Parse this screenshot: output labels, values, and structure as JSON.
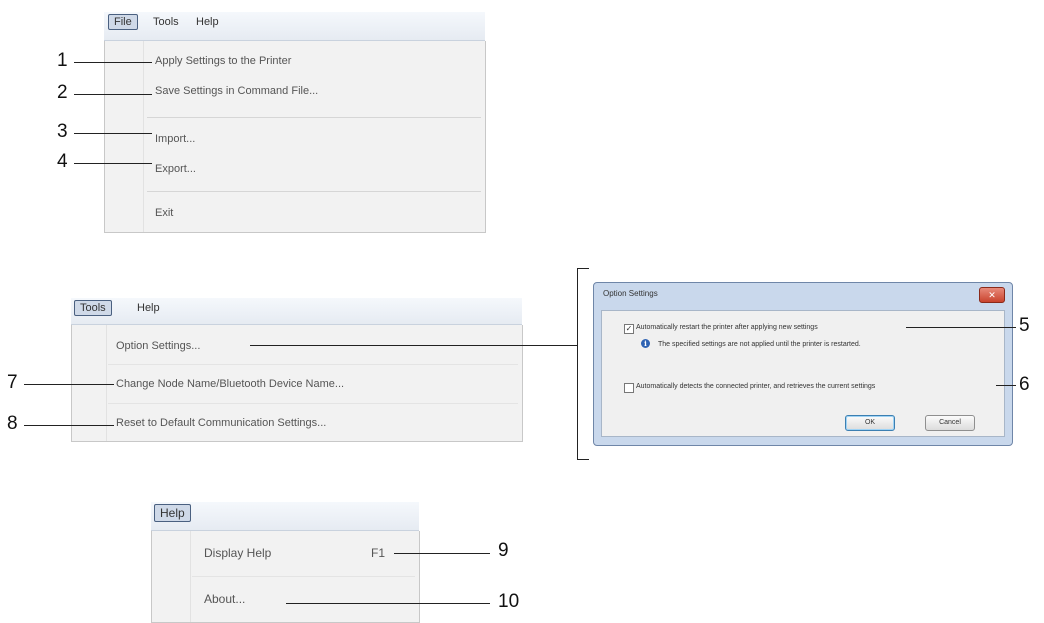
{
  "file_menu": {
    "menubar": [
      "File",
      "Tools",
      "Help"
    ],
    "items": [
      "Apply Settings to the Printer",
      "Save Settings in Command File...",
      "Import...",
      "Export...",
      "Exit"
    ]
  },
  "tools_menu": {
    "menubar": [
      "Tools",
      "Help"
    ],
    "items": [
      "Option Settings...",
      "Change Node Name/Bluetooth Device Name...",
      "Reset to Default Communication Settings..."
    ]
  },
  "help_menu": {
    "menubar": [
      "Help"
    ],
    "items": [
      {
        "label": "Display Help",
        "shortcut": "F1"
      },
      {
        "label": "About..."
      }
    ]
  },
  "option_dialog": {
    "title": "Option Settings",
    "close_icon": "close-icon",
    "option1_label": "Automatically restart the printer after applying new settings",
    "option1_checked": true,
    "info_icon": "info-icon",
    "info_text": "The specified settings are not applied until the printer is restarted.",
    "option2_label": "Automatically detects the connected printer, and retrieves the current settings",
    "option2_checked": false,
    "ok_label": "OK",
    "cancel_label": "Cancel"
  },
  "callouts": [
    "1",
    "2",
    "3",
    "4",
    "5",
    "6",
    "7",
    "8",
    "9",
    "10"
  ]
}
